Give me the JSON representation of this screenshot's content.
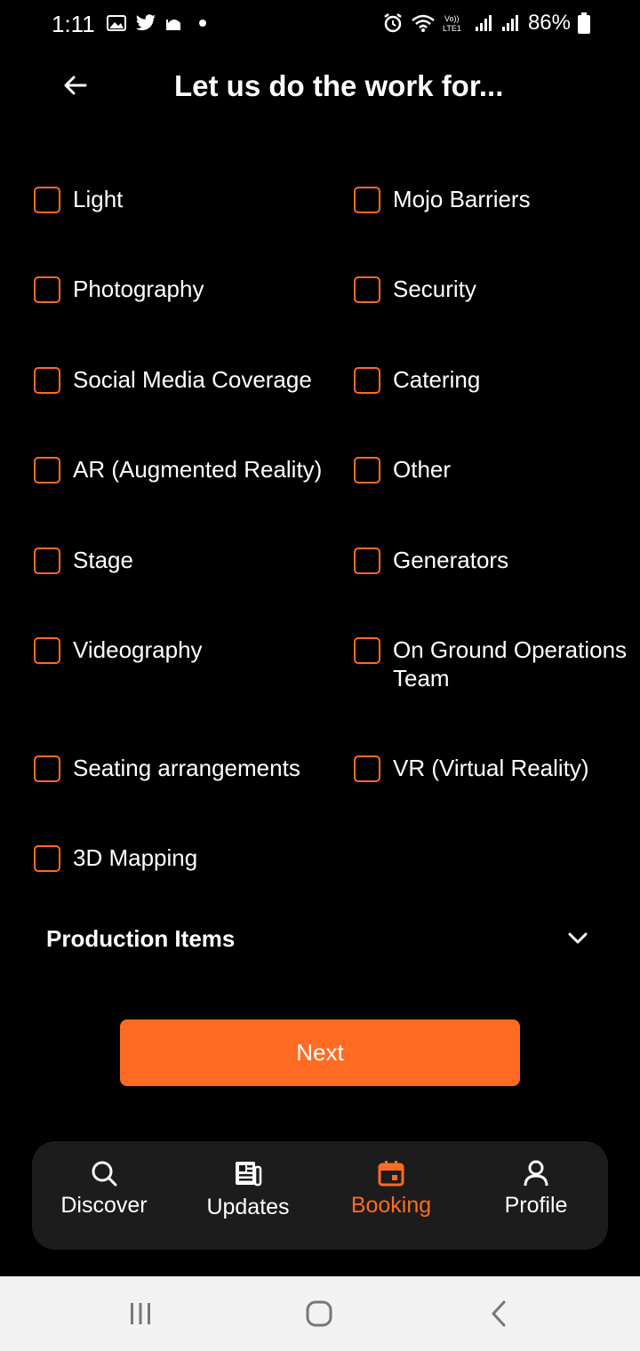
{
  "status_bar": {
    "time": "1:11",
    "battery": "86%"
  },
  "header": {
    "title": "Let us do the work for..."
  },
  "services": {
    "left": [
      "Light",
      "Photography",
      "Social Media Coverage",
      "AR (Augmented Reality)",
      "Stage",
      "Videography",
      "Seating arrangements",
      "3D Mapping"
    ],
    "right": [
      "Mojo Barriers",
      "Security",
      "Catering",
      "Other",
      "Generators",
      "On Ground Operations Team",
      "VR (Virtual Reality)"
    ]
  },
  "production": {
    "title": "Production Items"
  },
  "next_button": {
    "label": "Next"
  },
  "bottom_nav": {
    "items": [
      {
        "label": "Discover",
        "icon": "search-icon"
      },
      {
        "label": "Updates",
        "icon": "newspaper-icon"
      },
      {
        "label": "Booking",
        "icon": "calendar-icon",
        "active": true
      },
      {
        "label": "Profile",
        "icon": "person-icon"
      }
    ]
  },
  "colors": {
    "accent": "#FF6B22",
    "background": "#000000",
    "nav_bg": "#1c1c1c"
  }
}
